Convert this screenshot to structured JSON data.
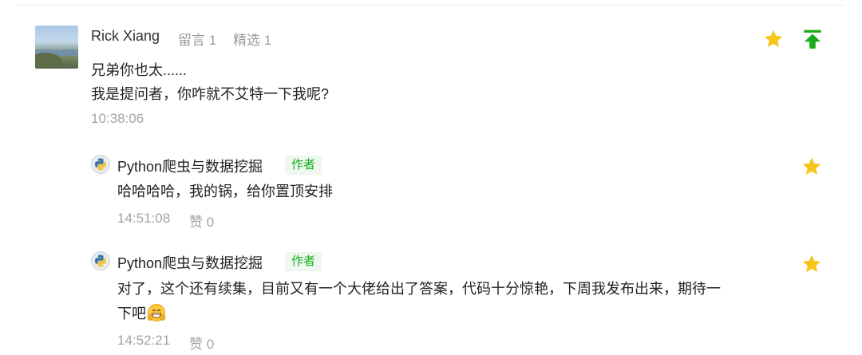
{
  "comment": {
    "username": "Rick Xiang",
    "reply_count_label": "留言 1",
    "featured_label": "精选 1",
    "lines": [
      "兄弟你也太......",
      "我是提问者，你咋就不艾特一下我呢?"
    ],
    "time": "10:38:06"
  },
  "replies": [
    {
      "name": "Python爬虫与数据挖掘",
      "badge": "作者",
      "lines": [
        "哈哈哈哈，我的锅，给你置顶安排"
      ],
      "time": "14:51:08",
      "likes": "赞 0"
    },
    {
      "name": "Python爬虫与数据挖掘",
      "badge": "作者",
      "lines": [
        "对了，这个还有续集，目前又有一个大佬给出了答案，代码十分惊艳，下周我发布出来，期待一",
        "下吧"
      ],
      "time": "14:52:21",
      "likes": "赞 0"
    }
  ],
  "icons": {
    "star": "star-icon",
    "pin": "pin-top-icon",
    "reply_avatar": "python-logo-icon",
    "emoji": "grinning-emoji-icon"
  },
  "colors": {
    "star": "#f7c518",
    "pin": "#1aad19",
    "badge_text": "#1aad19",
    "badge_bg": "#eef7f0"
  }
}
